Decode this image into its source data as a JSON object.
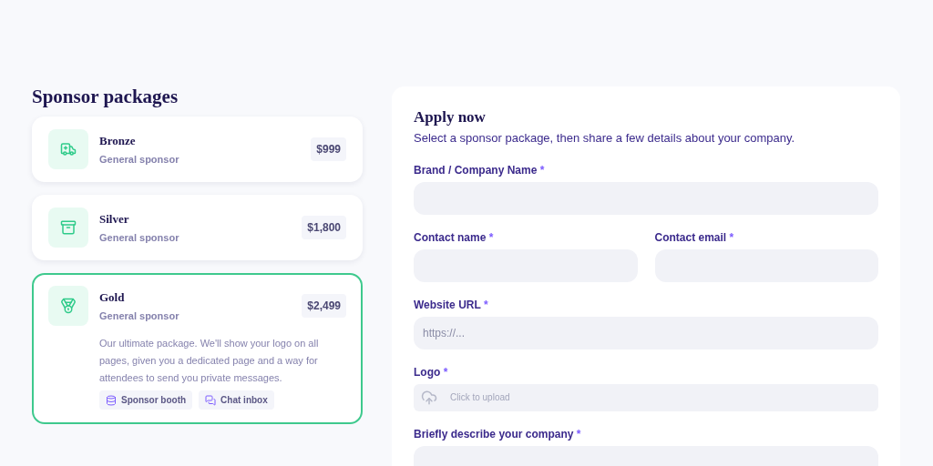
{
  "packages_title": "Sponsor packages",
  "packages": [
    {
      "name": "Bronze",
      "tier": "General sponsor",
      "price": "$999",
      "selected": false
    },
    {
      "name": "Silver",
      "tier": "General sponsor",
      "price": "$1,800",
      "selected": false
    },
    {
      "name": "Gold",
      "tier": "General sponsor",
      "price": "$2,499",
      "selected": true,
      "description": "Our ultimate package. We'll show your logo on all pages, given you a dedicated page and a way for attendees to send you private messages.",
      "features": [
        "Sponsor booth",
        "Chat inbox"
      ]
    }
  ],
  "form": {
    "title": "Apply now",
    "subtitle": "Select a sponsor package, then share a few details about your company.",
    "rows": [
      [
        {
          "kind": "text",
          "label": "Brand / Company Name",
          "mark": "*"
        }
      ],
      [
        {
          "kind": "text",
          "label": "Contact name",
          "mark": "*"
        },
        {
          "kind": "text",
          "label": "Contact email",
          "mark": "*"
        }
      ],
      [
        {
          "kind": "text",
          "label": "Website URL",
          "mark": "*",
          "placeholder": "https://..."
        }
      ],
      [
        {
          "kind": "upload",
          "label": "Logo",
          "mark": "*",
          "placeholder": "Click to upload"
        }
      ],
      [
        {
          "kind": "textarea",
          "label": "Briefly describe your company",
          "mark": "*"
        }
      ]
    ]
  }
}
